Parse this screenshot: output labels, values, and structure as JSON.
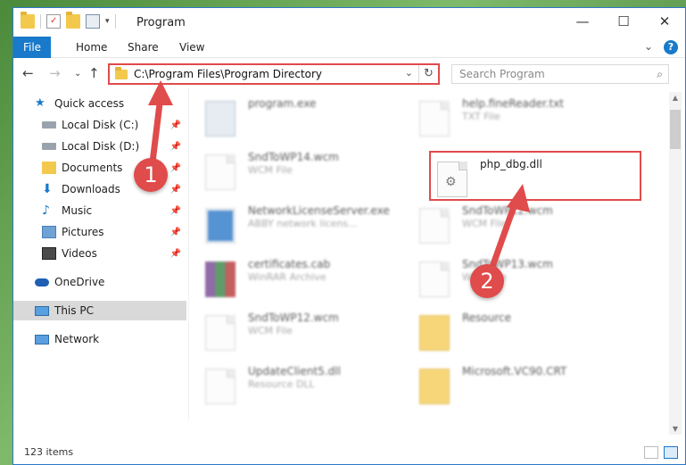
{
  "window": {
    "title": "Program"
  },
  "ribbon": {
    "tabs": [
      "File",
      "Home",
      "Share",
      "View"
    ]
  },
  "nav": {
    "address": "C:\\Program Files\\Program Directory",
    "search_placeholder": "Search Program"
  },
  "sidebar": {
    "items": [
      {
        "label": "Quick access",
        "icon": "star-icon"
      },
      {
        "label": "Local Disk (C:)",
        "icon": "drive-icon",
        "pinned": true
      },
      {
        "label": "Local Disk (D:)",
        "icon": "drive-icon",
        "pinned": true
      },
      {
        "label": "Documents",
        "icon": "documents-icon",
        "pinned": true
      },
      {
        "label": "Downloads",
        "icon": "download-icon",
        "pinned": true
      },
      {
        "label": "Music",
        "icon": "music-icon",
        "pinned": true
      },
      {
        "label": "Pictures",
        "icon": "pictures-icon",
        "pinned": true
      },
      {
        "label": "Videos",
        "icon": "videos-icon",
        "pinned": true
      },
      {
        "label": "OneDrive",
        "icon": "cloud-icon"
      },
      {
        "label": "This PC",
        "icon": "computer-icon",
        "selected": true
      },
      {
        "label": "Network",
        "icon": "network-icon"
      }
    ]
  },
  "files": {
    "left": [
      {
        "name": "program.exe",
        "desc": ""
      },
      {
        "name": "SndToWP14.wcm",
        "desc": "WCM File"
      },
      {
        "name": "NetworkLicenseServer.exe",
        "desc": "ABBY network licens..."
      },
      {
        "name": "certificates.cab",
        "desc": "WinRAR Archive"
      },
      {
        "name": "SndToWP12.wcm",
        "desc": "WCM File"
      },
      {
        "name": "UpdateClient5.dll",
        "desc": "Resource DLL"
      }
    ],
    "right": [
      {
        "name": "help.fineReader.txt",
        "desc": "TXT File"
      },
      {
        "name": "php_dbg.dll",
        "desc": ""
      },
      {
        "name": "SndToWP12.wcm",
        "desc": "WCM File"
      },
      {
        "name": "SndToWP13.wcm",
        "desc": "WCM File"
      },
      {
        "name": "Resource",
        "desc": ""
      },
      {
        "name": "Microsoft.VC90.CRT",
        "desc": ""
      }
    ]
  },
  "status": {
    "items_count": "123 items"
  },
  "annotations": {
    "badge1": "1",
    "badge2": "2"
  },
  "colors": {
    "accent": "#1979ca",
    "annotation": "#e04b4b",
    "folder": "#f3c94d"
  }
}
